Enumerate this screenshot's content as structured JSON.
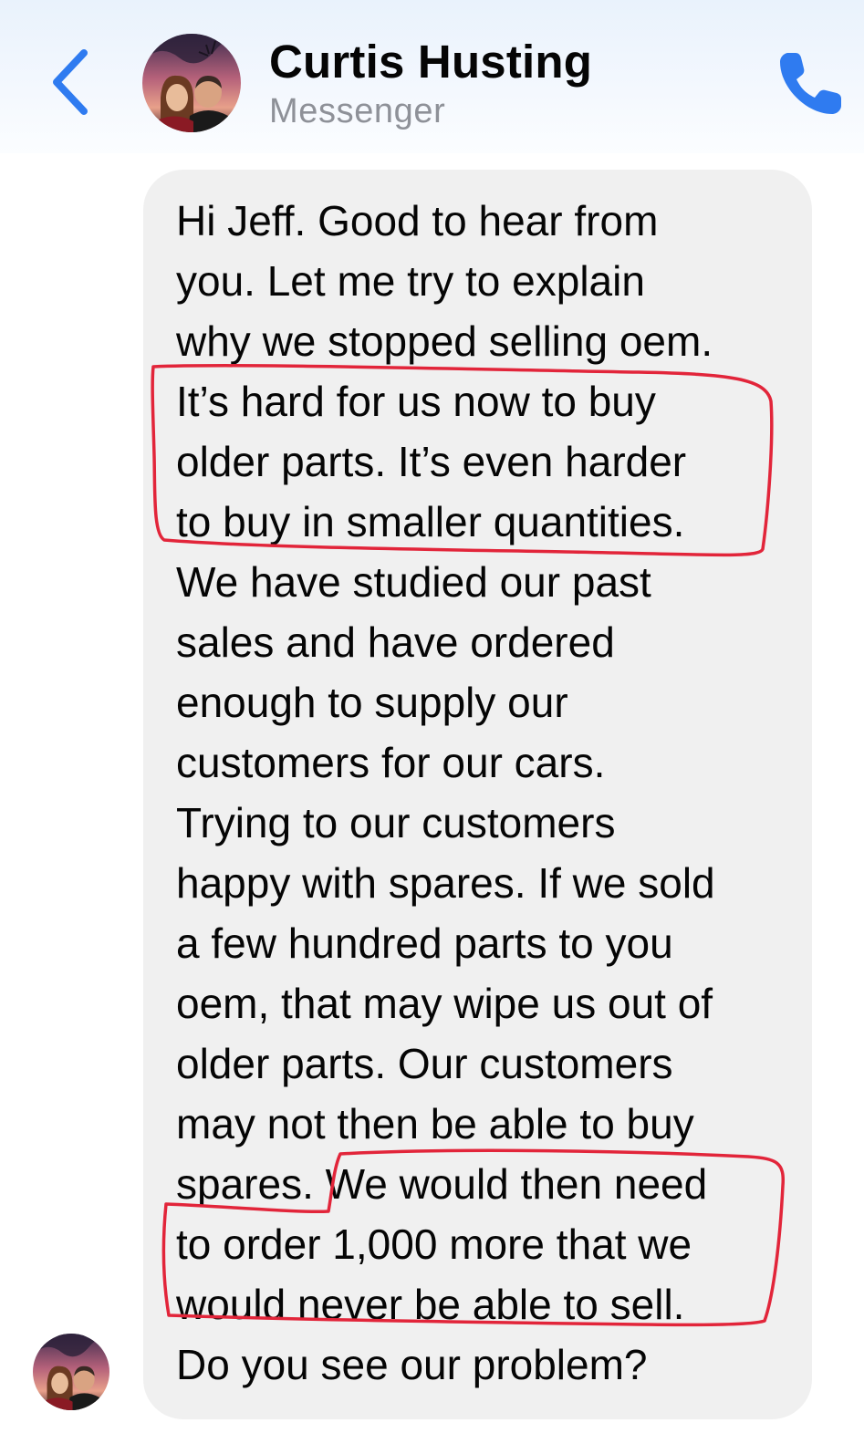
{
  "header": {
    "contact_name": "Curtis Husting",
    "subtitle": "Messenger",
    "back_icon": "chevron-left-icon",
    "call_icon": "phone-icon"
  },
  "message": {
    "lines": [
      "Hi Jeff. Good to hear from",
      "you. Let me try to explain",
      "why we stopped selling oem.",
      "It’s hard for us now to buy",
      "older parts. It’s even harder",
      "to buy in smaller quantities.",
      "We have studied our past",
      "sales and have ordered",
      "enough to supply our",
      "customers for our cars.",
      "Trying to our customers",
      "happy with spares. If we sold",
      "a few hundred parts to you",
      "oem, that may wipe us out of",
      "older parts. Our customers",
      "may not then be able to buy",
      "spares. We would then need",
      "to order 1,000 more that we",
      "would never be able to sell.",
      "Do you see our problem?"
    ]
  },
  "colors": {
    "accent": "#2f7bf0",
    "bubble": "#f0f0f0",
    "annotation": "#e2253a",
    "text": "#050505",
    "subtext": "#8e9198"
  }
}
